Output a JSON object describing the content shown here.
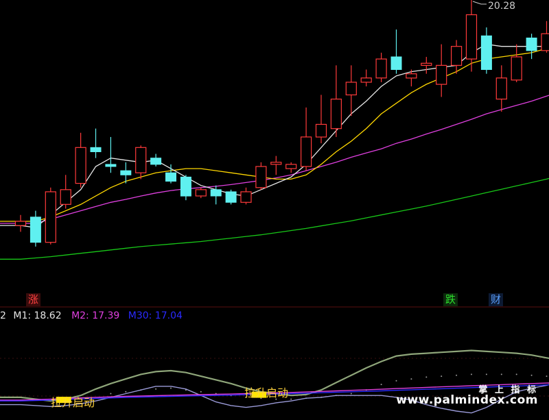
{
  "chart_data": [
    {
      "type": "candlestick",
      "panel": "price",
      "annotations": {
        "high_label": "20.28",
        "up_tag": "涨",
        "down_tag": "跌",
        "info_tag": "财"
      },
      "colors": {
        "up": "#ff3a3a",
        "down": "#5ff0f0",
        "ma_white": "#e6e6e6",
        "ma_yellow": "#ffd700",
        "ma_magenta": "#e040e0",
        "ma_green": "#18c818"
      },
      "ylim": [
        13.2,
        20.45
      ],
      "candles": [
        {
          "o": 15.1,
          "h": 15.35,
          "l": 14.95,
          "c": 15.2
        },
        {
          "o": 15.3,
          "h": 15.45,
          "l": 14.6,
          "c": 14.7
        },
        {
          "o": 14.7,
          "h": 16.0,
          "l": 14.65,
          "c": 15.9
        },
        {
          "o": 15.6,
          "h": 16.3,
          "l": 15.5,
          "c": 15.95
        },
        {
          "o": 16.1,
          "h": 17.3,
          "l": 16.0,
          "c": 16.95
        },
        {
          "o": 16.95,
          "h": 17.4,
          "l": 16.7,
          "c": 16.85
        },
        {
          "o": 16.55,
          "h": 17.2,
          "l": 16.35,
          "c": 16.5
        },
        {
          "o": 16.4,
          "h": 16.6,
          "l": 16.1,
          "c": 16.3
        },
        {
          "o": 16.35,
          "h": 17.0,
          "l": 16.2,
          "c": 16.95
        },
        {
          "o": 16.7,
          "h": 16.8,
          "l": 16.5,
          "c": 16.55
        },
        {
          "o": 16.35,
          "h": 16.55,
          "l": 16.1,
          "c": 16.15
        },
        {
          "o": 16.25,
          "h": 16.3,
          "l": 15.7,
          "c": 15.8
        },
        {
          "o": 15.8,
          "h": 16.0,
          "l": 15.75,
          "c": 15.95
        },
        {
          "o": 15.95,
          "h": 16.05,
          "l": 15.6,
          "c": 15.8
        },
        {
          "o": 15.9,
          "h": 15.95,
          "l": 15.6,
          "c": 15.65
        },
        {
          "o": 15.65,
          "h": 16.0,
          "l": 15.6,
          "c": 15.9
        },
        {
          "o": 16.0,
          "h": 16.6,
          "l": 15.95,
          "c": 16.5
        },
        {
          "o": 16.55,
          "h": 16.75,
          "l": 16.3,
          "c": 16.6
        },
        {
          "o": 16.45,
          "h": 16.6,
          "l": 16.35,
          "c": 16.55
        },
        {
          "o": 16.5,
          "h": 17.9,
          "l": 16.4,
          "c": 17.2
        },
        {
          "o": 17.2,
          "h": 18.2,
          "l": 17.05,
          "c": 17.5
        },
        {
          "o": 17.4,
          "h": 18.9,
          "l": 17.2,
          "c": 18.1
        },
        {
          "o": 18.2,
          "h": 18.9,
          "l": 17.7,
          "c": 18.5
        },
        {
          "o": 18.5,
          "h": 18.8,
          "l": 18.4,
          "c": 18.6
        },
        {
          "o": 18.6,
          "h": 19.2,
          "l": 18.5,
          "c": 19.05
        },
        {
          "o": 19.1,
          "h": 19.75,
          "l": 18.7,
          "c": 18.8
        },
        {
          "o": 18.6,
          "h": 18.8,
          "l": 18.4,
          "c": 18.7
        },
        {
          "o": 18.9,
          "h": 19.1,
          "l": 18.7,
          "c": 18.95
        },
        {
          "o": 18.45,
          "h": 19.4,
          "l": 18.15,
          "c": 18.9
        },
        {
          "o": 18.9,
          "h": 19.5,
          "l": 18.7,
          "c": 19.35
        },
        {
          "o": 19.05,
          "h": 20.45,
          "l": 18.75,
          "c": 20.1
        },
        {
          "o": 19.6,
          "h": 19.8,
          "l": 18.7,
          "c": 18.8
        },
        {
          "o": 18.1,
          "h": 18.9,
          "l": 17.8,
          "c": 18.6
        },
        {
          "o": 18.55,
          "h": 19.4,
          "l": 18.5,
          "c": 19.1
        },
        {
          "o": 19.55,
          "h": 19.65,
          "l": 19.05,
          "c": 19.25
        },
        {
          "o": 19.25,
          "h": 19.95,
          "l": 19.2,
          "c": 19.65
        },
        {
          "o": 19.2,
          "h": 20.2,
          "l": 19.1,
          "c": 19.9
        }
      ],
      "ma": {
        "white": [
          15.1,
          15.05,
          15.35,
          15.65,
          15.95,
          16.5,
          16.7,
          16.65,
          16.6,
          16.65,
          16.45,
          16.25,
          16.05,
          15.95,
          15.85,
          15.8,
          15.95,
          16.1,
          16.25,
          16.55,
          16.95,
          17.35,
          17.75,
          18.05,
          18.4,
          18.65,
          18.75,
          18.8,
          18.85,
          18.9,
          19.2,
          19.4,
          19.35,
          19.35,
          19.35,
          19.35,
          19.55
        ],
        "yellow": [
          15.2,
          15.2,
          15.3,
          15.45,
          15.6,
          15.8,
          16.0,
          16.15,
          16.25,
          16.35,
          16.4,
          16.45,
          16.45,
          16.4,
          16.35,
          16.3,
          16.25,
          16.2,
          16.2,
          16.3,
          16.55,
          16.85,
          17.1,
          17.4,
          17.75,
          18.0,
          18.25,
          18.45,
          18.6,
          18.75,
          18.95,
          19.05,
          19.1,
          19.15,
          19.2,
          19.3,
          19.45
        ],
        "magenta": [
          15.15,
          15.15,
          15.25,
          15.35,
          15.45,
          15.55,
          15.65,
          15.72,
          15.8,
          15.87,
          15.93,
          15.97,
          16.0,
          16.03,
          16.07,
          16.12,
          16.17,
          16.23,
          16.3,
          16.4,
          16.5,
          16.6,
          16.72,
          16.82,
          16.92,
          17.05,
          17.15,
          17.27,
          17.38,
          17.5,
          17.62,
          17.75,
          17.85,
          17.95,
          18.05,
          18.17,
          18.3
        ],
        "green": [
          14.3,
          14.33,
          14.36,
          14.4,
          14.44,
          14.48,
          14.52,
          14.56,
          14.6,
          14.63,
          14.66,
          14.69,
          14.72,
          14.76,
          14.8,
          14.84,
          14.88,
          14.93,
          14.98,
          15.03,
          15.09,
          15.15,
          15.21,
          15.28,
          15.35,
          15.42,
          15.49,
          15.56,
          15.64,
          15.72,
          15.8,
          15.88,
          15.96,
          16.04,
          16.12,
          16.2,
          16.3
        ]
      }
    },
    {
      "type": "line",
      "panel": "indicator",
      "legend": [
        {
          "label": "M1: 18.62",
          "color": "#e6e6e6"
        },
        {
          "label": "M2: 17.39",
          "color": "#e040e0"
        },
        {
          "label": "M30: 17.04",
          "color": "#2a2aff"
        }
      ],
      "left_fragment": "2",
      "signal_label": "拉升启动",
      "signals": [
        {
          "x": 3,
          "label": "拉升启动"
        },
        {
          "x": 16,
          "label": "拉升启动"
        }
      ],
      "ylim": [
        0,
        100
      ],
      "series": [
        {
          "name": "sage",
          "color": "#8fa67a",
          "values": [
            18,
            16,
            14,
            16,
            20,
            27,
            33,
            38,
            43,
            46,
            47,
            45,
            41,
            37,
            33,
            28,
            24,
            22,
            20,
            21,
            26,
            34,
            42,
            50,
            57,
            63,
            65,
            66,
            67,
            68,
            69,
            68,
            67,
            66,
            64,
            61,
            58
          ]
        },
        {
          "name": "dots",
          "color": "#9a9a9a",
          "values": [
            null,
            null,
            null,
            null,
            null,
            null,
            22,
            24,
            26,
            27,
            28,
            26,
            24,
            22,
            20,
            18,
            17,
            16,
            16,
            17,
            18,
            20,
            22,
            26,
            32,
            36,
            38,
            40,
            41,
            42,
            43,
            43,
            43,
            43,
            42,
            41,
            40
          ]
        },
        {
          "name": "lavender",
          "color": "#9a9ad8",
          "values": [
            10,
            9,
            8,
            9,
            11,
            14,
            18,
            22,
            26,
            30,
            30,
            27,
            20,
            13,
            9,
            7,
            9,
            12,
            14,
            17,
            18,
            20,
            20,
            20,
            20,
            18,
            15,
            10,
            6,
            3,
            1,
            7,
            16,
            24,
            28,
            31,
            37
          ]
        },
        {
          "name": "M2",
          "color": "#e040e0",
          "values": [
            15,
            15.5,
            16,
            16.7,
            17.4,
            18,
            18.5,
            19,
            19.4,
            19.8,
            20.2,
            20.5,
            20.9,
            21.3,
            21.6,
            22,
            22.4,
            22.8,
            23.3,
            23.8,
            24.4,
            25,
            25.6,
            26.2,
            26.8,
            27.5,
            28.1,
            28.8,
            29.4,
            30,
            30.6,
            31.2,
            31.8,
            32.4,
            33,
            33.5,
            34
          ]
        },
        {
          "name": "M30",
          "color": "#2a2aff",
          "values": [
            14,
            14.5,
            15,
            15.6,
            16.2,
            16.8,
            17.3,
            17.8,
            18.2,
            18.6,
            19,
            19.3,
            19.7,
            20,
            20.4,
            20.8,
            21.2,
            21.6,
            22,
            22.5,
            23,
            23.5,
            24,
            24.5,
            25,
            25.6,
            26.2,
            26.8,
            27.3,
            27.9,
            28.5,
            29.1,
            29.7,
            30.3,
            30.9,
            31.5,
            32
          ]
        }
      ]
    }
  ],
  "watermark": {
    "cn": "掌 上 指 标",
    "url": "www.palmindex.com"
  }
}
